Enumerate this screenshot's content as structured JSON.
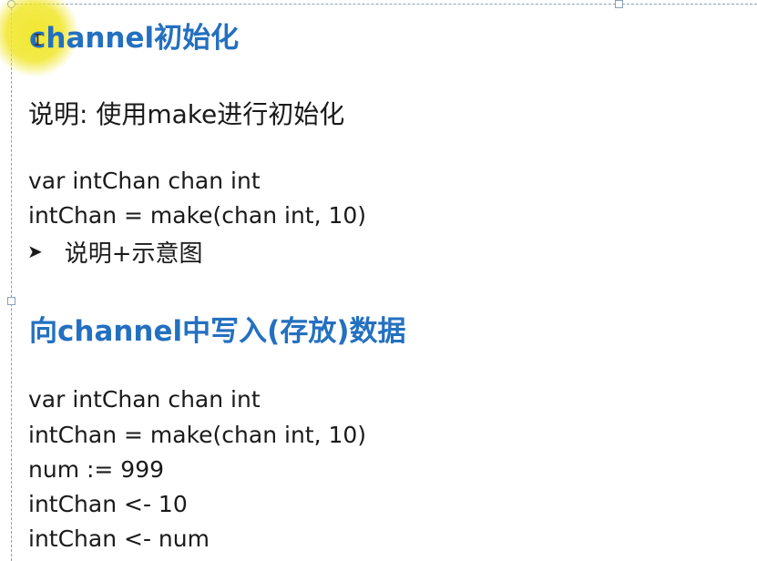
{
  "sections": [
    {
      "heading": "channel初始化",
      "description": "说明: 使用make进行初始化",
      "code": [
        "var  intChan  chan  int",
        "intChan = make(chan int, 10)"
      ],
      "bullet": "说明+示意图"
    },
    {
      "heading": "向channel中写入(存放)数据",
      "code": [
        "var  intChan  chan  int",
        "intChan = make(chan int, 10)",
        "num := 999",
        "intChan <- 10",
        "intChan <- num"
      ]
    }
  ],
  "colors": {
    "heading": "#2470c0",
    "text": "#1a1a1a",
    "cursor_highlight": "#f0e628",
    "frame": "#8aa0b8"
  },
  "icons": {
    "bullet": "arrowhead-bullet-icon",
    "cursor": "text-cursor-icon"
  }
}
